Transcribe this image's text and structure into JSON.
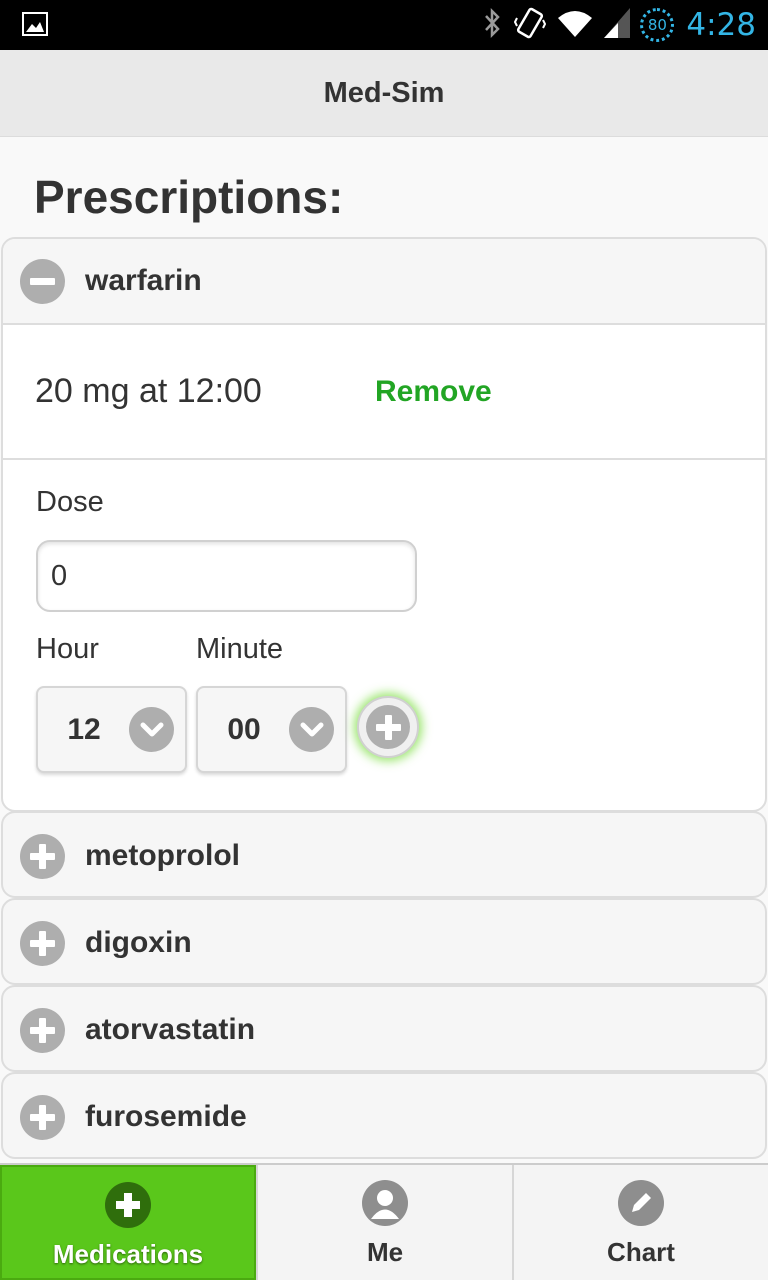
{
  "status_bar": {
    "time": "4:28",
    "battery_level": "80",
    "icons": [
      "image-icon",
      "bluetooth-icon",
      "vibrate-icon",
      "wifi-icon",
      "signal-icon",
      "battery-icon"
    ]
  },
  "header": {
    "title": "Med-Sim"
  },
  "page": {
    "heading": "Prescriptions:"
  },
  "expanded_medication": {
    "name": "warfarin",
    "prescription_text": "20 mg at 12:00",
    "remove_label": "Remove",
    "dose_label": "Dose",
    "dose_value": "0",
    "hour_label": "Hour",
    "hour_value": "12",
    "minute_label": "Minute",
    "minute_value": "00"
  },
  "medications": [
    {
      "name": "metoprolol"
    },
    {
      "name": "digoxin"
    },
    {
      "name": "atorvastatin"
    },
    {
      "name": "furosemide"
    }
  ],
  "nav": {
    "items": [
      {
        "label": "Medications",
        "icon": "plus-icon",
        "active": true
      },
      {
        "label": "Me",
        "icon": "user-icon",
        "active": false
      },
      {
        "label": "Chart",
        "icon": "pencil-icon",
        "active": false
      }
    ]
  },
  "colors": {
    "accent_green": "#5ac71b",
    "remove_green": "#22a524",
    "status_blue": "#33b5e5"
  }
}
